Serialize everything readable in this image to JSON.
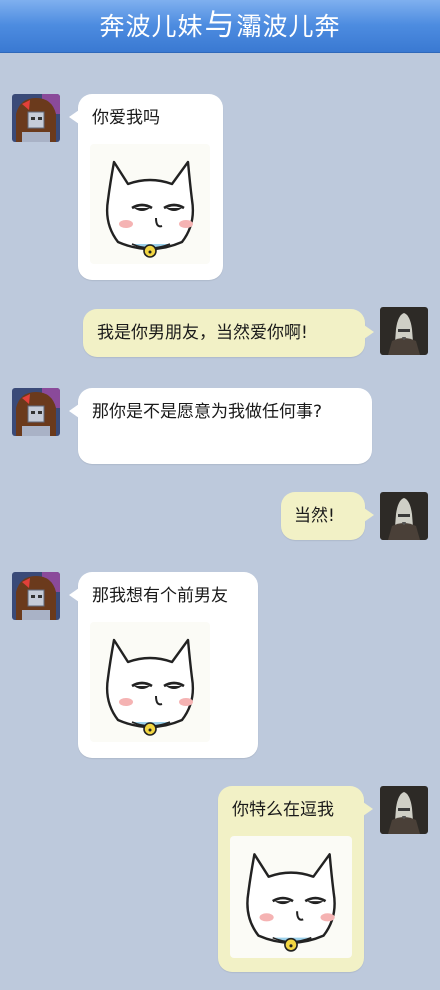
{
  "header": {
    "left_name": "奔波儿妹",
    "separator": "与",
    "right_name": "灞波儿奔"
  },
  "messages": [
    {
      "sender": "left",
      "text": "你爱我吗",
      "sticker": "sulky-cat-sticker"
    },
    {
      "sender": "right",
      "text": "我是你男朋友，当然爱你啊!"
    },
    {
      "sender": "left",
      "text": "那你是不是愿意为我做任何事?"
    },
    {
      "sender": "right",
      "text": "当然!"
    },
    {
      "sender": "left",
      "text": "那我想有个前男友",
      "sticker": "sulky-cat-sticker"
    },
    {
      "sender": "right",
      "text": "你特么在逗我",
      "sticker": "sulky-cat-sticker"
    }
  ],
  "colors": {
    "background": "#bdc9dc",
    "header": "#4d8ce0",
    "left_bubble": "#ffffff",
    "right_bubble": "#f2f1c6"
  },
  "icons": {
    "left_avatar": "girl-avatar-icon",
    "right_avatar": "bald-man-avatar-icon"
  }
}
